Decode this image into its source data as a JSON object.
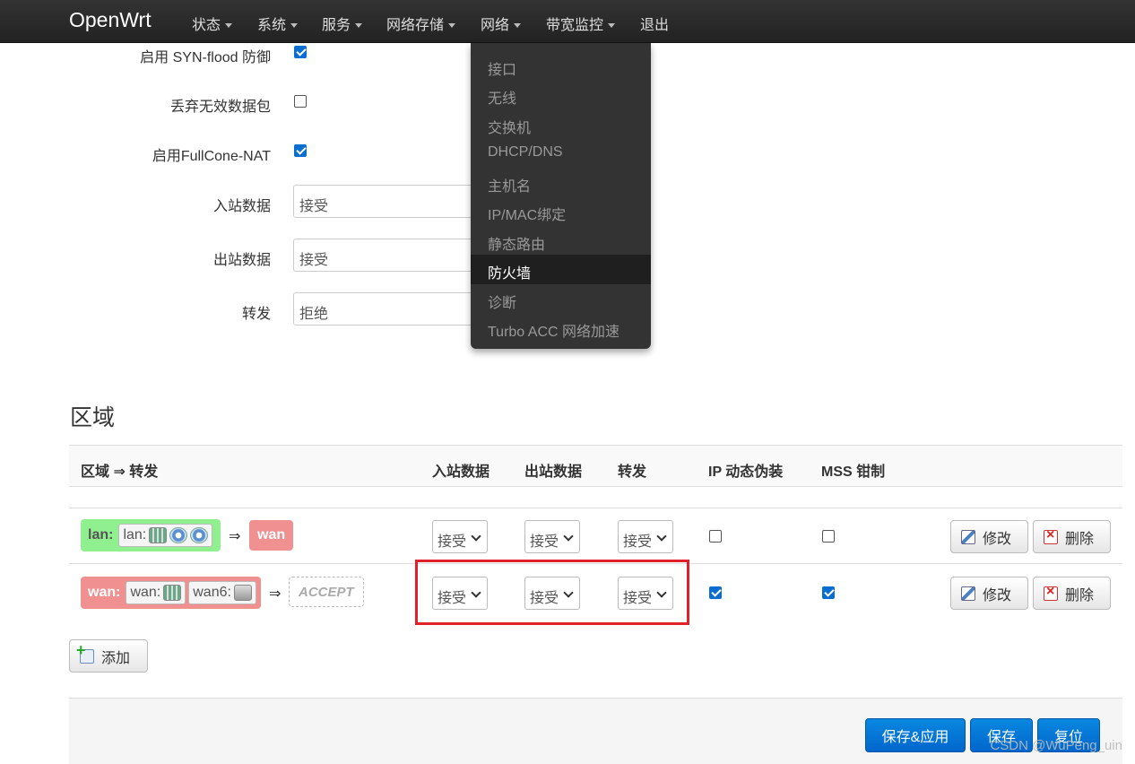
{
  "navbar": {
    "brand": "OpenWrt",
    "menu": [
      "状态",
      "系统",
      "服务",
      "网络存储",
      "网络",
      "带宽监控",
      "退出"
    ]
  },
  "dropdown": {
    "items": [
      "接口",
      "无线",
      "交换机",
      "DHCP/DNS",
      "主机名",
      "IP/MAC绑定",
      "静态路由",
      "防火墙",
      "诊断",
      "Turbo ACC 网络加速"
    ],
    "active": "防火墙"
  },
  "general": {
    "syn_flood_label": "启用 SYN-flood 防御",
    "syn_flood_checked": true,
    "drop_invalid_label": "丢弃无效数据包",
    "drop_invalid_checked": false,
    "fullcone_label": "启用FullCone-NAT",
    "fullcone_checked": true,
    "input_label": "入站数据",
    "input_value": "接受",
    "output_label": "出站数据",
    "output_value": "接受",
    "forward_label": "转发",
    "forward_value": "拒绝"
  },
  "zones": {
    "title": "区域",
    "headers": [
      "区域 ⇒ 转发",
      "入站数据",
      "出站数据",
      "转发",
      "IP 动态伪装",
      "MSS 钳制"
    ],
    "rows": [
      {
        "zone": "lan:",
        "networks": [
          "lan:"
        ],
        "arrow": "⇒",
        "dest": "wan",
        "input": "接受",
        "output": "接受",
        "forward": "接受",
        "masq": false,
        "mss": false,
        "edit": "修改",
        "delete": "删除"
      },
      {
        "zone": "wan:",
        "networks": [
          "wan:",
          "wan6:"
        ],
        "arrow": "⇒",
        "dest": "ACCEPT",
        "input": "接受",
        "output": "接受",
        "forward": "接受",
        "masq": true,
        "mss": true,
        "edit": "修改",
        "delete": "删除"
      }
    ],
    "add_label": "添加"
  },
  "footer": {
    "save_apply": "保存&应用",
    "save": "保存",
    "reset": "复位"
  },
  "watermark": "CSDN @WuPeng_uin"
}
